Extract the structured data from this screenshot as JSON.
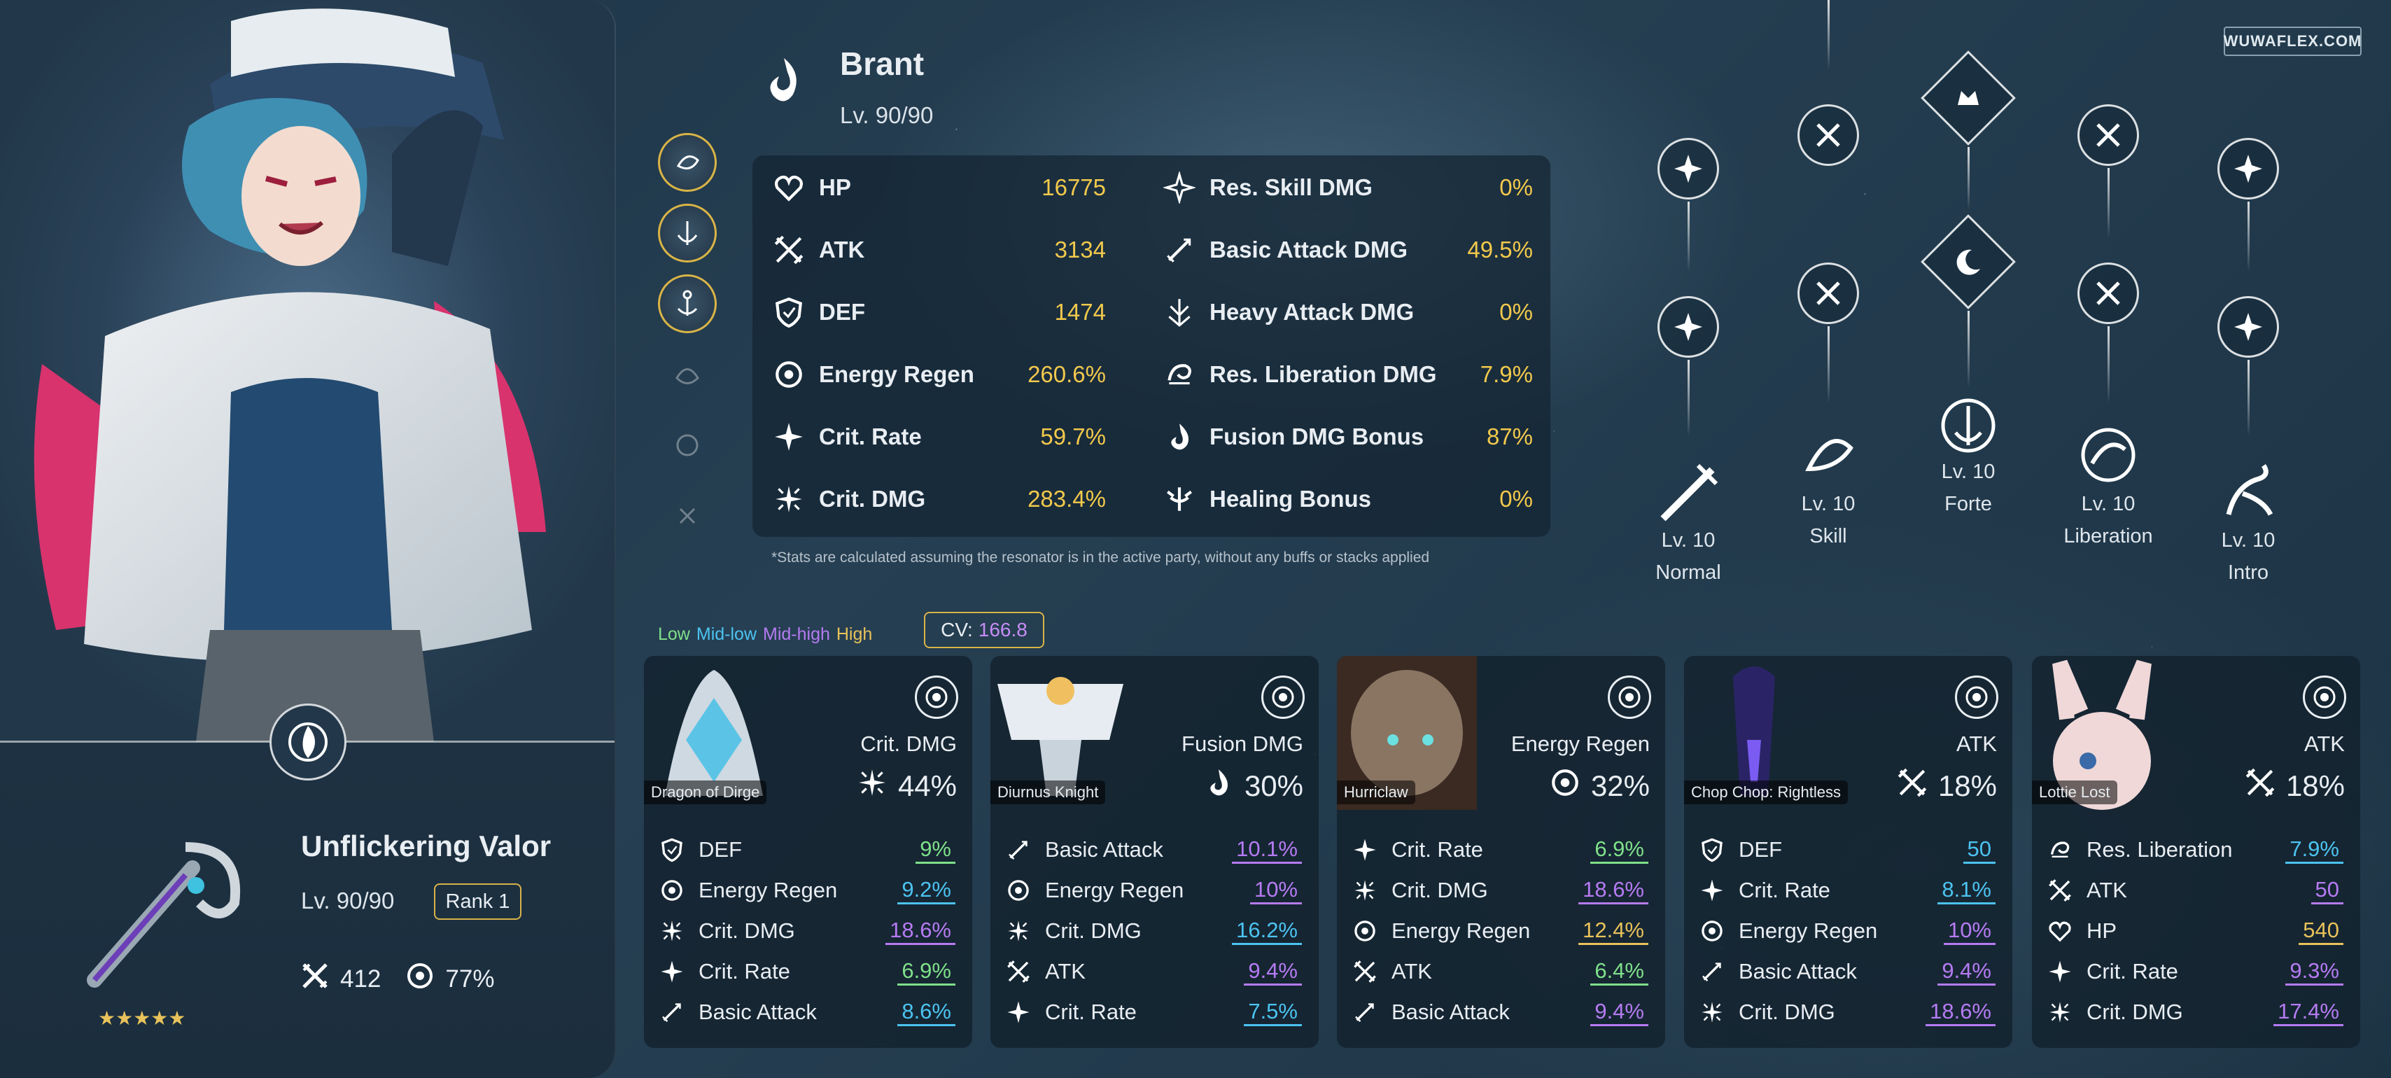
{
  "watermark": "WUWAFLEX.COM",
  "character": {
    "name": "Brant",
    "level": "Lv. 90/90",
    "element_icon": "fusion-icon"
  },
  "stats_left": [
    {
      "label": "HP",
      "value": "16775",
      "icon": "heart-icon"
    },
    {
      "label": "ATK",
      "value": "3134",
      "icon": "atk-swords-icon"
    },
    {
      "label": "DEF",
      "value": "1474",
      "icon": "shield-icon"
    },
    {
      "label": "Energy Regen",
      "value": "260.6%",
      "icon": "energy-regen-icon"
    },
    {
      "label": "Crit. Rate",
      "value": "59.7%",
      "icon": "crit-rate-icon"
    },
    {
      "label": "Crit. DMG",
      "value": "283.4%",
      "icon": "crit-dmg-icon"
    }
  ],
  "stats_right": [
    {
      "label": "Res. Skill DMG",
      "value": "0%",
      "icon": "skill-dmg-icon"
    },
    {
      "label": "Basic Attack DMG",
      "value": "49.5%",
      "icon": "basic-attack-icon"
    },
    {
      "label": "Heavy Attack DMG",
      "value": "0%",
      "icon": "heavy-attack-icon"
    },
    {
      "label": "Res. Liberation DMG",
      "value": "7.9%",
      "icon": "liberation-icon"
    },
    {
      "label": "Fusion DMG Bonus",
      "value": "87%",
      "icon": "fusion-icon"
    },
    {
      "label": "Healing Bonus",
      "value": "0%",
      "icon": "healing-icon"
    }
  ],
  "disclaimer": "*Stats are calculated assuming the resonator is in the active party, without any buffs or stacks applied",
  "sequence_chain": {
    "active": 3,
    "total": 6
  },
  "skills": [
    {
      "level": "Lv. 10",
      "name": "Normal"
    },
    {
      "level": "Lv. 10",
      "name": "Skill"
    },
    {
      "level": "Lv. 10",
      "name": "Forte"
    },
    {
      "level": "Lv. 10",
      "name": "Liberation"
    },
    {
      "level": "Lv. 10",
      "name": "Intro"
    }
  ],
  "weapon": {
    "name": "Unflickering Valor",
    "level": "Lv. 90/90",
    "rank": "Rank 1",
    "atk": "412",
    "energy_regen": "77%",
    "stars": "★★★★★"
  },
  "legend": [
    {
      "label": "Low",
      "color": "#7fe08a"
    },
    {
      "label": "Mid-low",
      "color": "#4cc3f0"
    },
    {
      "label": "Mid-high",
      "color": "#b57bf2"
    },
    {
      "label": "High",
      "color": "#e8c25a"
    }
  ],
  "cv": {
    "label": "CV:",
    "value": "166.8"
  },
  "echoes": [
    {
      "name": "Dragon of Dirge",
      "main_stat": "Crit. DMG",
      "main_value": "44%",
      "main_icon": "crit-dmg-icon",
      "subs": [
        {
          "label": "DEF",
          "value": "9%",
          "tier": "low",
          "icon": "shield-icon"
        },
        {
          "label": "Energy Regen",
          "value": "9.2%",
          "tier": "midlow",
          "icon": "energy-regen-icon"
        },
        {
          "label": "Crit. DMG",
          "value": "18.6%",
          "tier": "midhigh",
          "icon": "crit-dmg-icon"
        },
        {
          "label": "Crit. Rate",
          "value": "6.9%",
          "tier": "low",
          "icon": "crit-rate-icon"
        },
        {
          "label": "Basic Attack",
          "value": "8.6%",
          "tier": "midlow",
          "icon": "basic-attack-icon"
        }
      ]
    },
    {
      "name": "Diurnus Knight",
      "main_stat": "Fusion DMG",
      "main_value": "30%",
      "main_icon": "fusion-icon",
      "subs": [
        {
          "label": "Basic Attack",
          "value": "10.1%",
          "tier": "midhigh",
          "icon": "basic-attack-icon"
        },
        {
          "label": "Energy Regen",
          "value": "10%",
          "tier": "midhigh",
          "icon": "energy-regen-icon"
        },
        {
          "label": "Crit. DMG",
          "value": "16.2%",
          "tier": "midlow",
          "icon": "crit-dmg-icon"
        },
        {
          "label": "ATK",
          "value": "9.4%",
          "tier": "midhigh",
          "icon": "atk-swords-icon"
        },
        {
          "label": "Crit. Rate",
          "value": "7.5%",
          "tier": "midlow",
          "icon": "crit-rate-icon"
        }
      ]
    },
    {
      "name": "Hurriclaw",
      "main_stat": "Energy Regen",
      "main_value": "32%",
      "main_icon": "energy-regen-icon",
      "subs": [
        {
          "label": "Crit. Rate",
          "value": "6.9%",
          "tier": "low",
          "icon": "crit-rate-icon"
        },
        {
          "label": "Crit. DMG",
          "value": "18.6%",
          "tier": "midhigh",
          "icon": "crit-dmg-icon"
        },
        {
          "label": "Energy Regen",
          "value": "12.4%",
          "tier": "high",
          "icon": "energy-regen-icon"
        },
        {
          "label": "ATK",
          "value": "6.4%",
          "tier": "low",
          "icon": "atk-swords-icon"
        },
        {
          "label": "Basic Attack",
          "value": "9.4%",
          "tier": "midhigh",
          "icon": "basic-attack-icon"
        }
      ]
    },
    {
      "name": "Chop Chop: Rightless",
      "main_stat": "ATK",
      "main_value": "18%",
      "main_icon": "atk-swords-icon",
      "subs": [
        {
          "label": "DEF",
          "value": "50",
          "tier": "midlow",
          "icon": "shield-icon"
        },
        {
          "label": "Crit. Rate",
          "value": "8.1%",
          "tier": "midlow",
          "icon": "crit-rate-icon"
        },
        {
          "label": "Energy Regen",
          "value": "10%",
          "tier": "midhigh",
          "icon": "energy-regen-icon"
        },
        {
          "label": "Basic Attack",
          "value": "9.4%",
          "tier": "midhigh",
          "icon": "basic-attack-icon"
        },
        {
          "label": "Crit. DMG",
          "value": "18.6%",
          "tier": "midhigh",
          "icon": "crit-dmg-icon"
        }
      ]
    },
    {
      "name": "Lottie Lost",
      "main_stat": "ATK",
      "main_value": "18%",
      "main_icon": "atk-swords-icon",
      "subs": [
        {
          "label": "Res. Liberation",
          "value": "7.9%",
          "tier": "midlow",
          "icon": "liberation-icon"
        },
        {
          "label": "ATK",
          "value": "50",
          "tier": "midhigh",
          "icon": "atk-swords-icon"
        },
        {
          "label": "HP",
          "value": "540",
          "tier": "high",
          "icon": "heart-icon"
        },
        {
          "label": "Crit. Rate",
          "value": "9.3%",
          "tier": "midhigh",
          "icon": "crit-rate-icon"
        },
        {
          "label": "Crit. DMG",
          "value": "17.4%",
          "tier": "midhigh",
          "icon": "crit-dmg-icon"
        }
      ]
    }
  ],
  "tier_colors": {
    "low": "#7fe08a",
    "midlow": "#4cc3f0",
    "midhigh": "#b57bf2",
    "high": "#e8c25a"
  }
}
